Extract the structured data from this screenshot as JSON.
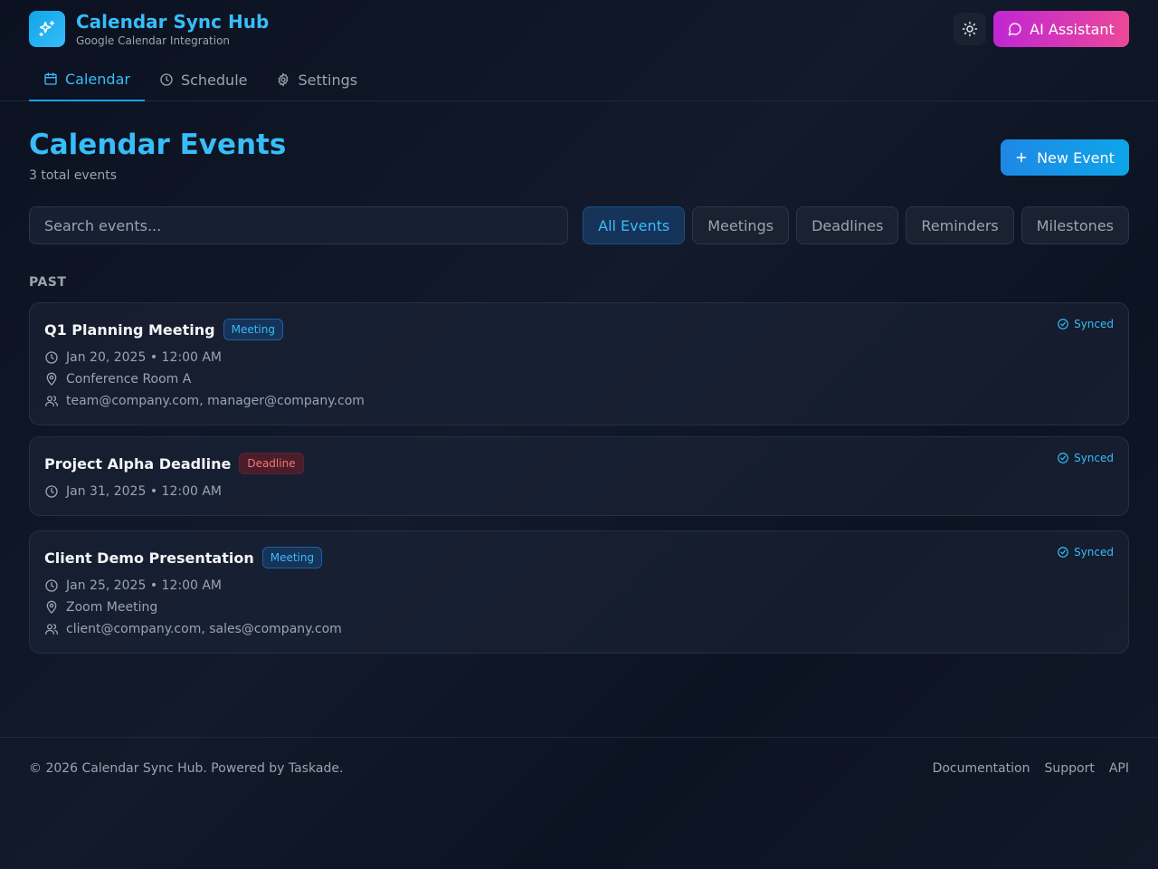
{
  "app": {
    "title": "Calendar Sync Hub",
    "subtitle": "Google Calendar Integration",
    "ai_label": "AI Assistant"
  },
  "tabs": [
    {
      "label": "Calendar",
      "icon": "calendar-icon",
      "active": true
    },
    {
      "label": "Schedule",
      "icon": "clock-icon",
      "active": false
    },
    {
      "label": "Settings",
      "icon": "gear-icon",
      "active": false
    }
  ],
  "page": {
    "title": "Calendar Events",
    "count": "3 total events",
    "new_label": "New Event",
    "search_placeholder": "Search events...",
    "section": "PAST"
  },
  "filters": [
    {
      "label": "All Events",
      "active": true
    },
    {
      "label": "Meetings",
      "active": false
    },
    {
      "label": "Deadlines",
      "active": false
    },
    {
      "label": "Reminders",
      "active": false
    },
    {
      "label": "Milestones",
      "active": false
    }
  ],
  "events": [
    {
      "title": "Q1 Planning Meeting",
      "type": "Meeting",
      "datetime": "Jan 20, 2025 • 12:00 AM",
      "location": "Conference Room A",
      "attendees": "team@company.com, manager@company.com",
      "status": "Synced"
    },
    {
      "title": "Project Alpha Deadline",
      "type": "Deadline",
      "datetime": "Jan 31, 2025 • 12:00 AM",
      "status": "Synced"
    },
    {
      "title": "Client Demo Presentation",
      "type": "Meeting",
      "datetime": "Jan 25, 2025 • 12:00 AM",
      "location": "Zoom Meeting",
      "attendees": "client@company.com, sales@company.com",
      "status": "Synced"
    }
  ],
  "footer": {
    "copyright": "© 2026 Calendar Sync Hub. Powered by Taskade.",
    "links": [
      "Documentation",
      "Support",
      "API"
    ]
  },
  "colors": {
    "accent": "#38bdf8",
    "ai_gradient_start": "#c026d3",
    "ai_gradient_end": "#ec4899",
    "deadline": "#f87171"
  }
}
